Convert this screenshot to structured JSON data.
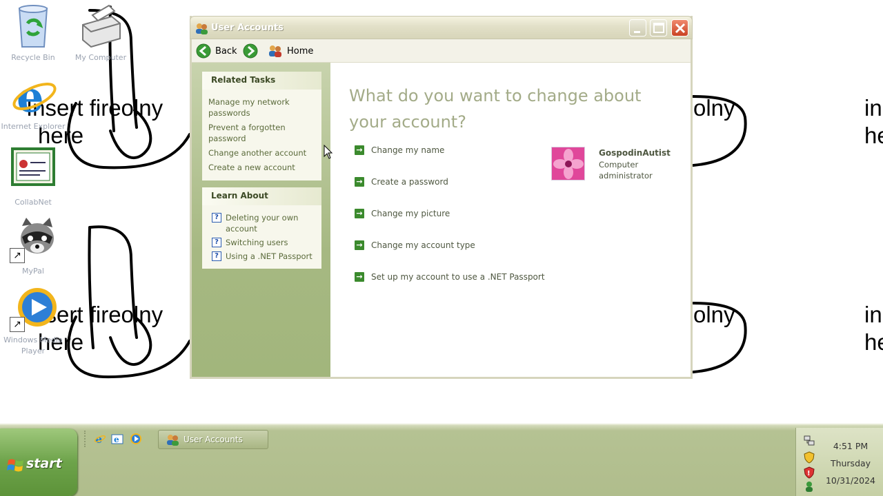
{
  "wallpaper": {
    "doodle_lines": [
      "Insert fireolny",
      "here"
    ],
    "doodle_lines_right_a": [
      "olny"
    ],
    "doodle_lines_right_b": [
      "in",
      "he"
    ]
  },
  "desktop_icons": [
    {
      "label": "Recycle Bin",
      "icon": "recycle-bin-icon"
    },
    {
      "label": "My Computer",
      "icon": "printer-icon"
    },
    {
      "label": "Internet Explorer",
      "icon": "internet-explorer-icon"
    },
    {
      "label": "CollabNet",
      "icon": "certificate-icon"
    },
    {
      "label": "MyPal",
      "icon": "raccoon-icon"
    },
    {
      "label": "Windows Media Player",
      "icon": "media-player-icon"
    }
  ],
  "window": {
    "title": "User Accounts",
    "toolbar": {
      "back": "Back",
      "home": "Home"
    },
    "related_tasks": {
      "title": "Related Tasks",
      "links": [
        "Manage my network passwords",
        "Prevent a forgotten password",
        "Change another account",
        "Create a new account"
      ]
    },
    "learn_about": {
      "title": "Learn About",
      "links": [
        "Deleting your own account",
        "Switching users",
        "Using a .NET Passport"
      ]
    },
    "heading": "What do you want to change about your account?",
    "actions": [
      "Change my name",
      "Create a password",
      "Change my picture",
      "Change my account type",
      "Set up my account to use a .NET Passport"
    ],
    "account": {
      "name": "GospodinAutist",
      "type": "Computer administrator"
    }
  },
  "taskbar": {
    "start_label": "start",
    "quick_launch": [
      "internet-explorer-icon",
      "email-icon",
      "media-player-icon"
    ],
    "task_button": "User Accounts",
    "clock": {
      "time": "4:51 PM",
      "day": "Thursday",
      "date": "10/31/2024"
    }
  },
  "colors": {
    "heading": "#a3ab88",
    "taskbar": "#b0bd8c",
    "start": "#6da34a",
    "action_arrow": "#3b8a2d"
  }
}
